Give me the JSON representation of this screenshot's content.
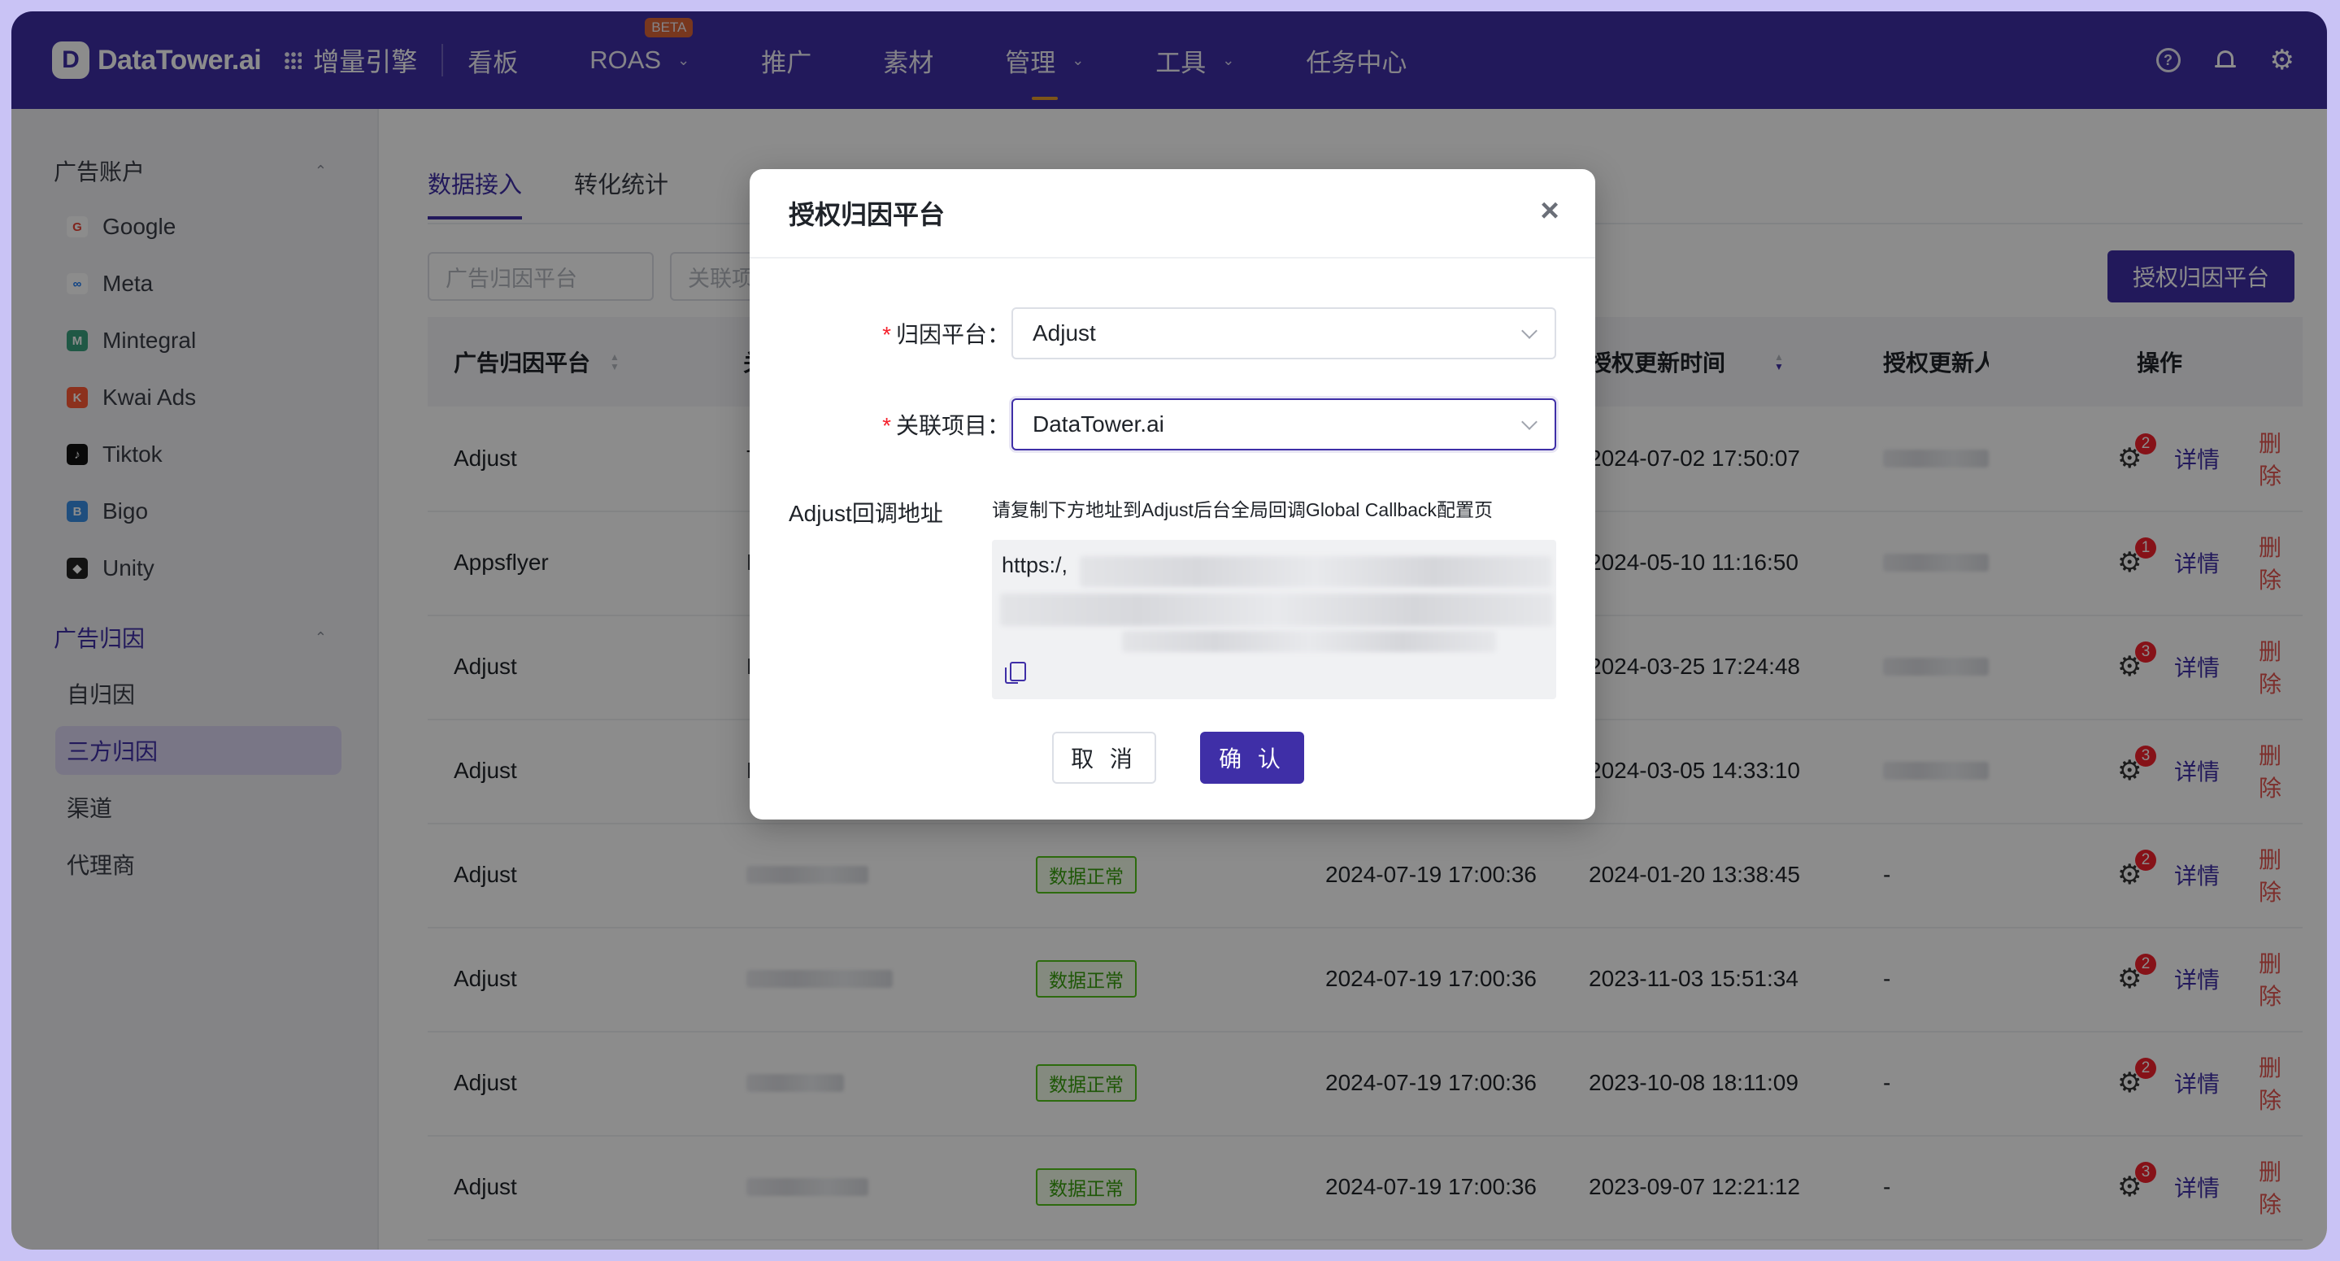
{
  "nav": {
    "logo_text": "DataTower.ai",
    "product": "增量引擎",
    "items": [
      {
        "label": "看板",
        "has_chevron": false,
        "active": false,
        "beta": ""
      },
      {
        "label": "ROAS",
        "has_chevron": true,
        "active": false,
        "beta": "BETA"
      },
      {
        "label": "推广",
        "has_chevron": false,
        "active": false,
        "beta": ""
      },
      {
        "label": "素材",
        "has_chevron": false,
        "active": false,
        "beta": ""
      },
      {
        "label": "管理",
        "has_chevron": true,
        "active": true,
        "beta": ""
      },
      {
        "label": "工具",
        "has_chevron": true,
        "active": false,
        "beta": ""
      },
      {
        "label": "任务中心",
        "has_chevron": false,
        "active": false,
        "beta": ""
      }
    ],
    "right_icons": [
      "help-icon",
      "bell-icon",
      "gear-icon"
    ],
    "help_glyph": "?"
  },
  "sidebar": {
    "group1": "广告账户",
    "accounts": [
      {
        "label": "Google",
        "icon": "google-icon",
        "glyph": "G",
        "color": "#ea4335",
        "bg": "#ffffff"
      },
      {
        "label": "Meta",
        "icon": "meta-icon",
        "glyph": "∞",
        "color": "#1877f2",
        "bg": "#ffffff"
      },
      {
        "label": "Mintegral",
        "icon": "mintegral-icon",
        "glyph": "M",
        "color": "#ffffff",
        "bg": "#3aa17e"
      },
      {
        "label": "Kwai Ads",
        "icon": "kwai-icon",
        "glyph": "K",
        "color": "#ffffff",
        "bg": "#ff5a36"
      },
      {
        "label": "Tiktok",
        "icon": "tiktok-icon",
        "glyph": "♪",
        "color": "#ffffff",
        "bg": "#111111"
      },
      {
        "label": "Bigo",
        "icon": "bigo-icon",
        "glyph": "B",
        "color": "#ffffff",
        "bg": "#3a8ee6"
      },
      {
        "label": "Unity",
        "icon": "unity-icon",
        "glyph": "◆",
        "color": "#ffffff",
        "bg": "#222222"
      }
    ],
    "group2": "广告归因",
    "attrib": [
      {
        "label": "自归因",
        "active": false
      },
      {
        "label": "三方归因",
        "active": true
      },
      {
        "label": "渠道",
        "active": false
      },
      {
        "label": "代理商",
        "active": false
      }
    ]
  },
  "main": {
    "tabs": [
      {
        "label": "数据接入",
        "active": true
      },
      {
        "label": "转化统计",
        "active": false
      }
    ],
    "filter_platform_placeholder": "广告归因平台",
    "filter_project_placeholder": "关联项",
    "primary_button": "授权归因平台",
    "columns": {
      "platform": "广告归因平台",
      "project_partial": "关",
      "auth_time": "授权更新时间",
      "auth_user_partial": "授权更新人",
      "actions": "操作"
    },
    "rows": [
      {
        "platform": "Adjust",
        "project_initial": "T",
        "status": "",
        "sync_time": "",
        "auth_time": "2024-07-02 17:50:07",
        "user": "",
        "badge": "2"
      },
      {
        "platform": "Appsflyer",
        "project_initial": "F",
        "status": "",
        "sync_time": "",
        "auth_time": "2024-05-10 11:16:50",
        "user": "",
        "badge": "1"
      },
      {
        "platform": "Adjust",
        "project_initial": "B",
        "status": "",
        "sync_time": "",
        "auth_time": "2024-03-25 17:24:48",
        "user": "",
        "badge": "3"
      },
      {
        "platform": "Adjust",
        "project_initial": "D",
        "status": "",
        "sync_time": "",
        "auth_time": "2024-03-05 14:33:10",
        "user": "",
        "badge": "3"
      },
      {
        "platform": "Adjust",
        "project_initial": "",
        "status": "数据正常",
        "sync_time": "2024-07-19 17:00:36",
        "auth_time": "2024-01-20 13:38:45",
        "user": "-",
        "badge": "2"
      },
      {
        "platform": "Adjust",
        "project_initial": "",
        "status": "数据正常",
        "sync_time": "2024-07-19 17:00:36",
        "auth_time": "2023-11-03 15:51:34",
        "user": "-",
        "badge": "2"
      },
      {
        "platform": "Adjust",
        "project_initial": "",
        "status": "数据正常",
        "sync_time": "2024-07-19 17:00:36",
        "auth_time": "2023-10-08 18:11:09",
        "user": "-",
        "badge": "2"
      },
      {
        "platform": "Adjust",
        "project_initial": "",
        "status": "数据正常",
        "sync_time": "2024-07-19 17:00:36",
        "auth_time": "2023-09-07 12:21:12",
        "user": "-",
        "badge": "3"
      }
    ],
    "detail_label": "详情",
    "delete_label": "删除"
  },
  "modal": {
    "title": "授权归因平台",
    "close_glyph": "×",
    "platform_label": "归因平台：",
    "platform_value": "Adjust",
    "project_label": "关联项目：",
    "project_value": "DataTower.ai",
    "required_mark": "*",
    "callback_label": "Adjust回调地址",
    "callback_hint": "请复制下方地址到Adjust后台全局回调Global Callback配置页",
    "callback_url_visible": "https:/,",
    "cancel_label": "取 消",
    "confirm_label": "确 认"
  },
  "colors": {
    "brand": "#3f2fa7",
    "danger": "#e4544f",
    "success": "#52c41a",
    "beta": "#e8692f"
  }
}
